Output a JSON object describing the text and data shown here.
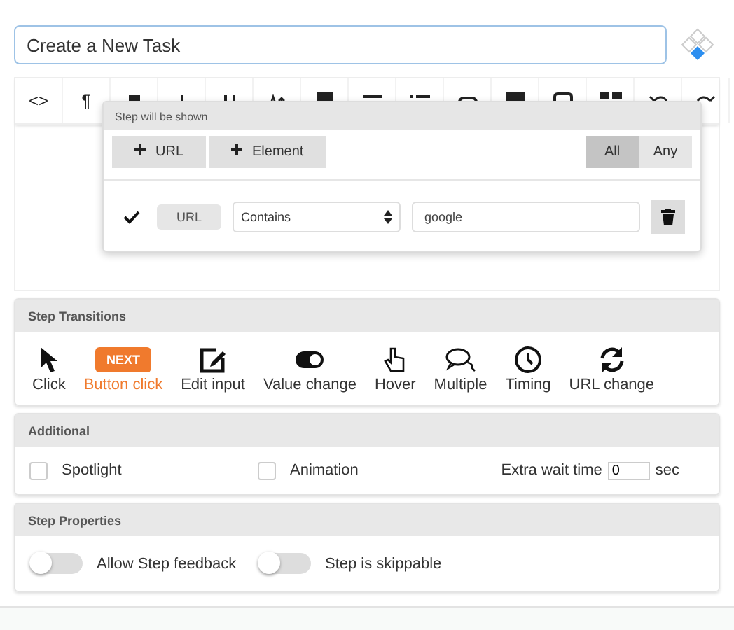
{
  "task_title": {
    "value": "Create a New Task"
  },
  "toolbar": [
    {
      "kind": "text",
      "label": "<>"
    },
    {
      "kind": "text",
      "label": "¶"
    },
    {
      "kind": "bold"
    },
    {
      "kind": "italic"
    },
    {
      "kind": "underline"
    },
    {
      "kind": "size"
    },
    {
      "kind": "font"
    },
    {
      "kind": "align"
    },
    {
      "kind": "list"
    },
    {
      "kind": "link"
    },
    {
      "kind": "image"
    },
    {
      "kind": "video"
    },
    {
      "kind": "table"
    },
    {
      "kind": "undo"
    },
    {
      "kind": "redo"
    }
  ],
  "condition_popup": {
    "title": "Step will be shown",
    "add_buttons": [
      "URL",
      "Element"
    ],
    "match_modes": [
      {
        "label": "All",
        "selected": true
      },
      {
        "label": "Any",
        "selected": false
      }
    ],
    "conditions": [
      {
        "checked": true,
        "type": "URL",
        "operator": "Contains",
        "value": "google"
      }
    ]
  },
  "step_transitions": {
    "title": "Step Transitions",
    "items": [
      {
        "kind": "click",
        "label": "Click",
        "selected": false
      },
      {
        "kind": "button",
        "badge": "NEXT",
        "label": "Button click",
        "selected": true
      },
      {
        "kind": "edit",
        "label": "Edit input",
        "selected": false
      },
      {
        "kind": "toggle",
        "label": "Value change",
        "selected": false
      },
      {
        "kind": "hover",
        "label": "Hover",
        "selected": false
      },
      {
        "kind": "multiple",
        "label": "Multiple",
        "selected": false
      },
      {
        "kind": "timing",
        "label": "Timing",
        "selected": false
      },
      {
        "kind": "url",
        "label": "URL change",
        "selected": false
      }
    ]
  },
  "additional": {
    "title": "Additional",
    "options": [
      {
        "label": "Spotlight",
        "checked": false
      },
      {
        "label": "Animation",
        "checked": false
      }
    ],
    "wait": {
      "label": "Extra wait time",
      "value": "0",
      "unit": "sec"
    }
  },
  "step_properties": {
    "title": "Step Properties",
    "toggles": [
      {
        "label": "Allow Step feedback",
        "on": false
      },
      {
        "label": "Step is skippable",
        "on": false
      }
    ]
  }
}
